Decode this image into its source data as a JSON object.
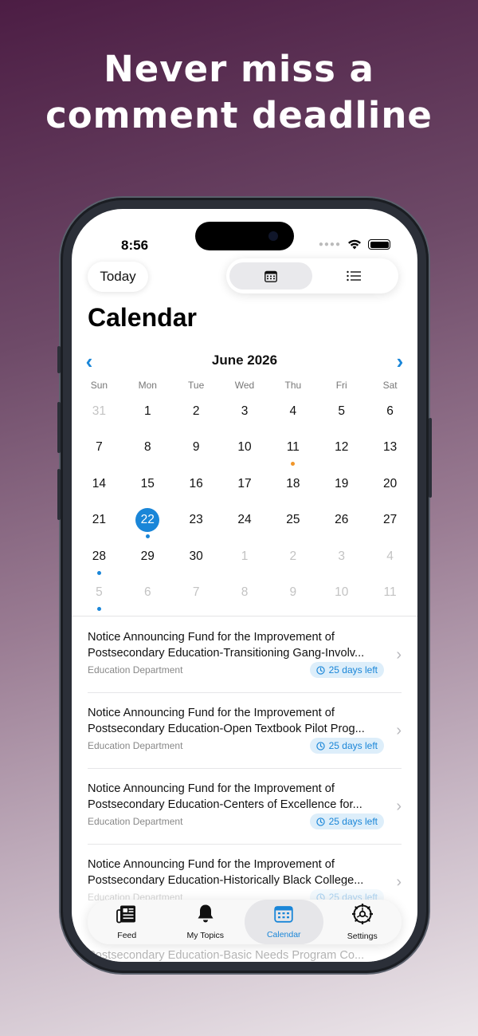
{
  "headline": {
    "line1": "Never miss a",
    "line2": "comment deadline"
  },
  "status_bar": {
    "time": "8:56"
  },
  "toolbar": {
    "today_label": "Today",
    "view_options": [
      {
        "icon": "calendar-grid-icon",
        "active": true
      },
      {
        "icon": "list-icon",
        "active": false
      }
    ]
  },
  "page": {
    "title": "Calendar"
  },
  "calendar": {
    "month_label": "June 2026",
    "weekdays": [
      "Sun",
      "Mon",
      "Tue",
      "Wed",
      "Thu",
      "Fri",
      "Sat"
    ],
    "weeks": [
      [
        {
          "d": "31",
          "o": true
        },
        {
          "d": "1"
        },
        {
          "d": "2"
        },
        {
          "d": "3"
        },
        {
          "d": "4"
        },
        {
          "d": "5"
        },
        {
          "d": "6"
        }
      ],
      [
        {
          "d": "7"
        },
        {
          "d": "8"
        },
        {
          "d": "9"
        },
        {
          "d": "10"
        },
        {
          "d": "11",
          "dot": "#f0962a"
        },
        {
          "d": "12"
        },
        {
          "d": "13"
        }
      ],
      [
        {
          "d": "14"
        },
        {
          "d": "15"
        },
        {
          "d": "16"
        },
        {
          "d": "17"
        },
        {
          "d": "18"
        },
        {
          "d": "19"
        },
        {
          "d": "20"
        }
      ],
      [
        {
          "d": "21"
        },
        {
          "d": "22",
          "sel": true,
          "dot": "#1a86d8"
        },
        {
          "d": "23"
        },
        {
          "d": "24"
        },
        {
          "d": "25"
        },
        {
          "d": "26"
        },
        {
          "d": "27"
        }
      ],
      [
        {
          "d": "28",
          "dot": "#1a86d8"
        },
        {
          "d": "29"
        },
        {
          "d": "30"
        },
        {
          "d": "1",
          "o": true
        },
        {
          "d": "2",
          "o": true
        },
        {
          "d": "3",
          "o": true
        },
        {
          "d": "4",
          "o": true
        }
      ],
      [
        {
          "d": "5",
          "o": true,
          "dot": "#1a86d8"
        },
        {
          "d": "6",
          "o": true
        },
        {
          "d": "7",
          "o": true
        },
        {
          "d": "8",
          "o": true
        },
        {
          "d": "9",
          "o": true
        },
        {
          "d": "10",
          "o": true
        },
        {
          "d": "11",
          "o": true
        }
      ]
    ]
  },
  "documents": [
    {
      "title_line1": "Notice Announcing Fund for the Improvement of",
      "title_line2": "Postsecondary Education-Transitioning Gang-Involv...",
      "agency": "Education Department",
      "deadline": "25 days left"
    },
    {
      "title_line1": "Notice Announcing Fund for the Improvement of",
      "title_line2": "Postsecondary Education-Open Textbook Pilot Prog...",
      "agency": "Education Department",
      "deadline": "25 days left"
    },
    {
      "title_line1": "Notice Announcing Fund for the Improvement of",
      "title_line2": "Postsecondary Education-Centers of Excellence for...",
      "agency": "Education Department",
      "deadline": "25 days left"
    },
    {
      "title_line1": "Notice Announcing Fund for the Improvement of",
      "title_line2": "Postsecondary Education-Historically Black College...",
      "agency": "Education Department",
      "deadline": "25 days left"
    }
  ],
  "ghost_row": "Postsecondary Education-Basic Needs Program Co...",
  "tabbar": {
    "tabs": [
      {
        "label": "Feed",
        "icon": "newspaper-icon",
        "active": false
      },
      {
        "label": "My Topics",
        "icon": "bell-icon",
        "active": false
      },
      {
        "label": "Calendar",
        "icon": "calendar-icon",
        "active": true
      },
      {
        "label": "Settings",
        "icon": "gear-icon",
        "active": false
      }
    ]
  },
  "colors": {
    "accent": "#1a86d8",
    "orange_marker": "#f0962a"
  }
}
